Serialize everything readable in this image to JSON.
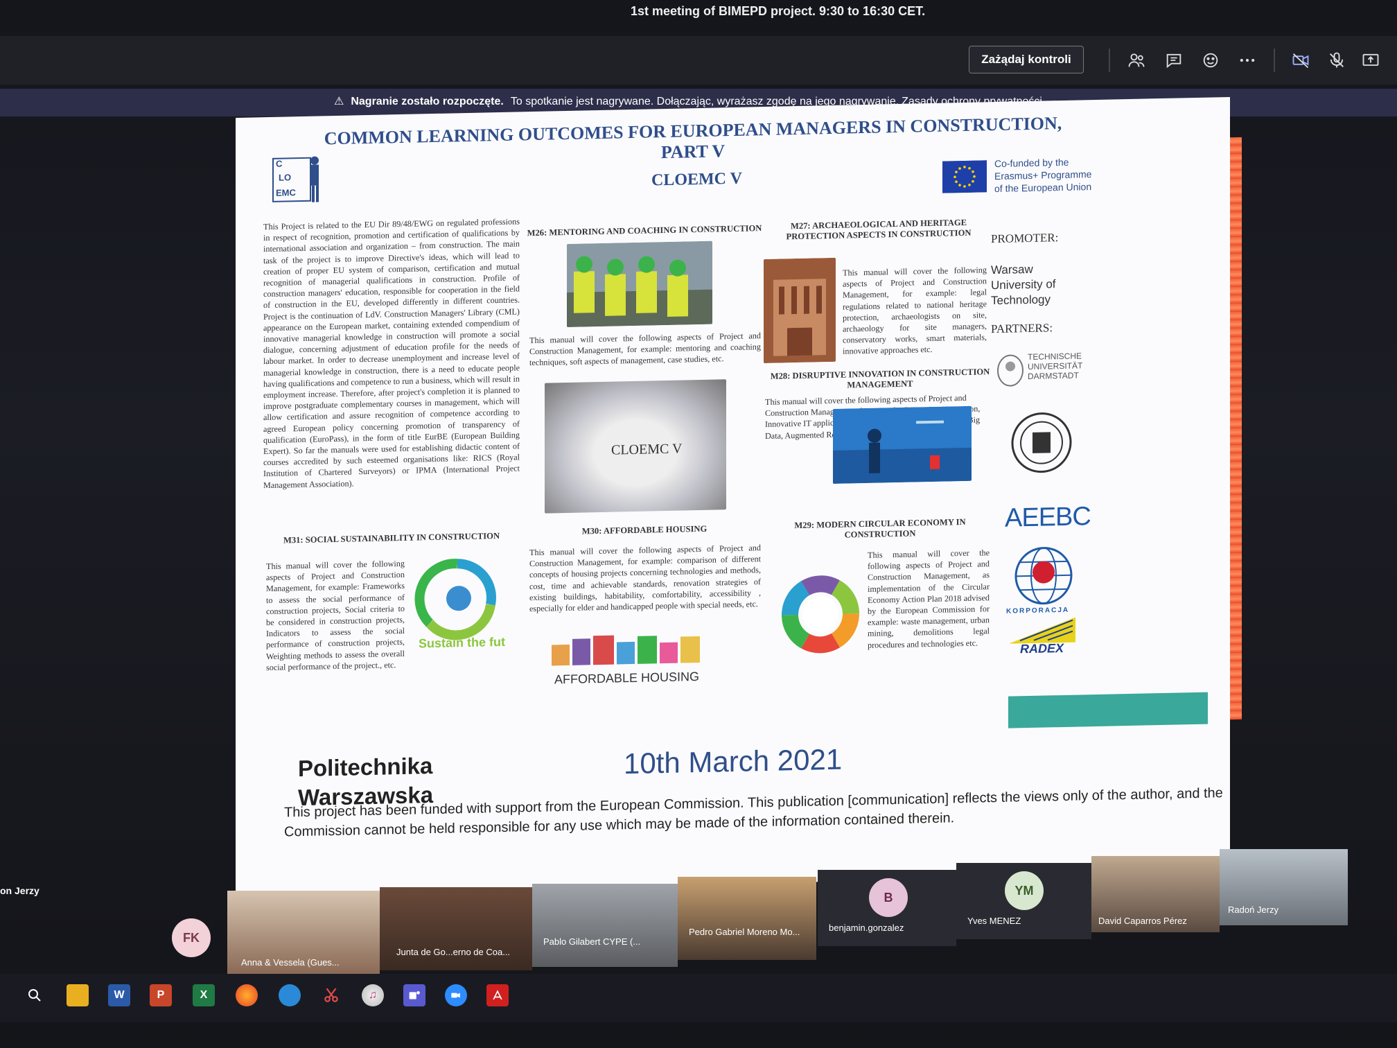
{
  "window": {
    "title": "1st meeting of BIMEPD project. 9:30 to 16:30 CET."
  },
  "toolbar": {
    "request_control": "Zażądaj kontroli"
  },
  "banner": {
    "bold": "Nagranie zostało rozpoczęte.",
    "text": "To spotkanie jest nagrywane. Dołączając, wyrażasz zgodę na jego nagrywanie.",
    "link": "Zasady ochrony prywatności"
  },
  "poster": {
    "title": "COMMON LEARNING OUTCOMES FOR EUROPEAN MANAGERS IN CONSTRUCTION, PART V",
    "logo_letters": [
      "C",
      "LO",
      "EMC"
    ],
    "acronym": "CLOEMC V",
    "cofunded": [
      "Co-funded by the",
      "Erasmus+ Programme",
      "of the European Union"
    ],
    "intro": "This Project is related to the EU Dir 89/48/EWG on regulated professions in respect of recognition, promotion and certification of qualifications by international association and organization – from construction. The main task of the project is to improve Directive's ideas, which will lead to creation of proper EU system of comparison, certification and mutual recognition of managerial qualifications in construction. Profile of construction managers' education, responsible for cooperation in the field of construction in the EU, developed differently in different countries. Project is the continuation of LdV. Construction Managers' Library (CML) appearance on the European market, containing extended compendium of innovative managerial knowledge in construction will promote a social dialogue, concerning adjustment of education profile for the needs of labour market. In order to decrease unemployment and increase level of managerial knowledge in construction, there is a need to educate people having qualifications and competence to run a business, which will result in employment increase. Therefore, after project's completion it is planned to improve postgraduate complementary courses in management, which will allow certification and assure recognition of competence according to agreed European policy concerning promotion of transparency of qualification (EuroPass), in the form of title EurBE (European Building Expert). So far the manuals were used for establishing didactic content of courses accredited by such esteemed organisations like: RICS (Royal Institution of Chartered Surveyors) or IPMA (International Project Management Association).",
    "m26": {
      "heading": "M26: MENTORING AND COACHING IN CONSTRUCTION",
      "text": "This manual will cover the following aspects of Project and Construction Management, for example: mentoring and coaching techniques, soft aspects of management, case studies, etc."
    },
    "m27": {
      "heading": "M27: ARCHAEOLOGICAL AND HERITAGE PROTECTION ASPECTS IN CONSTRUCTION",
      "text": "This manual will cover the following aspects of Project and Construction Management, for example: legal regulations related to national heritage protection, archaeologists on site, archaeology for site managers, conservatory works, smart materials, innovative approaches etc."
    },
    "m28": {
      "heading": "M28: DISRUPTIVE INNOVATION IN CONSTRUCTION MANAGEMENT",
      "text": "This manual will cover the following aspects of Project and Construction Management, for example: Disruptive innovation, Innovative IT applications in construction, Data Protection, Big Data, Augmented Reality, etc."
    },
    "center_image_label": "CLOEMC V",
    "m29": {
      "heading": "M29: MODERN CIRCULAR ECONOMY IN CONSTRUCTION",
      "text": "This manual will cover the following aspects of Project and Construction Management, as implementation of the Circular Economy Action Plan 2018 advised by the European Commission for example: waste management, urban mining, demolitions legal procedures and technologies etc."
    },
    "m30": {
      "heading": "M30: AFFORDABLE HOUSING",
      "text": "This manual will cover the following aspects of Project and Construction Management, for example: comparison of different concepts of housing projects concerning technologies and methods, cost, time and achievable standards, renovation strategies of existing buildings, habitability, comfortability, accessibility , especially for elder and handicapped people with special needs, etc.",
      "image_label": "AFFORDABLE HOUSING"
    },
    "m31": {
      "heading": "M31: SOCIAL SUSTAINABILITY IN CONSTRUCTION",
      "text": "This manual will cover the following aspects of Project and Construction Management, for example: Frameworks to assess the social performance of construction projects, Social criteria to be considered in construction projects, Indicators to assess the social performance of construction projects, Weighting methods to assess the overall social performance of the project., etc.",
      "image_label": "Sustain the future"
    },
    "promoter_label": "PROMOTER:",
    "promoter_name": "Warsaw University of Technology",
    "partners_label": "PARTNERS:",
    "tud": [
      "TECHNISCHE",
      "UNIVERSITÄT",
      "DARMSTADT"
    ],
    "aeebc": "AEEBC",
    "radex_top": "KORPORACJA",
    "radex": "RADEX",
    "pw": [
      "Politechnika",
      "Warszawska"
    ],
    "date": "10th March 2021",
    "disclaimer": "This project has been funded with support from the European Commission. This publication [communication] reflects the views only of the author, and the Commission cannot be held responsible for any use which may be made of the information contained therein."
  },
  "participants": {
    "left_name": "on Jerzy",
    "fk": "FK",
    "tiles": [
      "Anna & Vessela (Gues...",
      "Junta de Go...erno de Coa...",
      "Pablo Gilabert CYPE (...",
      "Pedro Gabriel Moreno Mo...",
      "benjamin.gonzalez",
      "Yves MENEZ",
      "David Caparros Pérez",
      "Radoń Jerzy"
    ],
    "b_initial": "B",
    "ym_initial": "YM"
  },
  "taskbar": {
    "word": "W",
    "powerpoint": "P",
    "excel": "X"
  }
}
